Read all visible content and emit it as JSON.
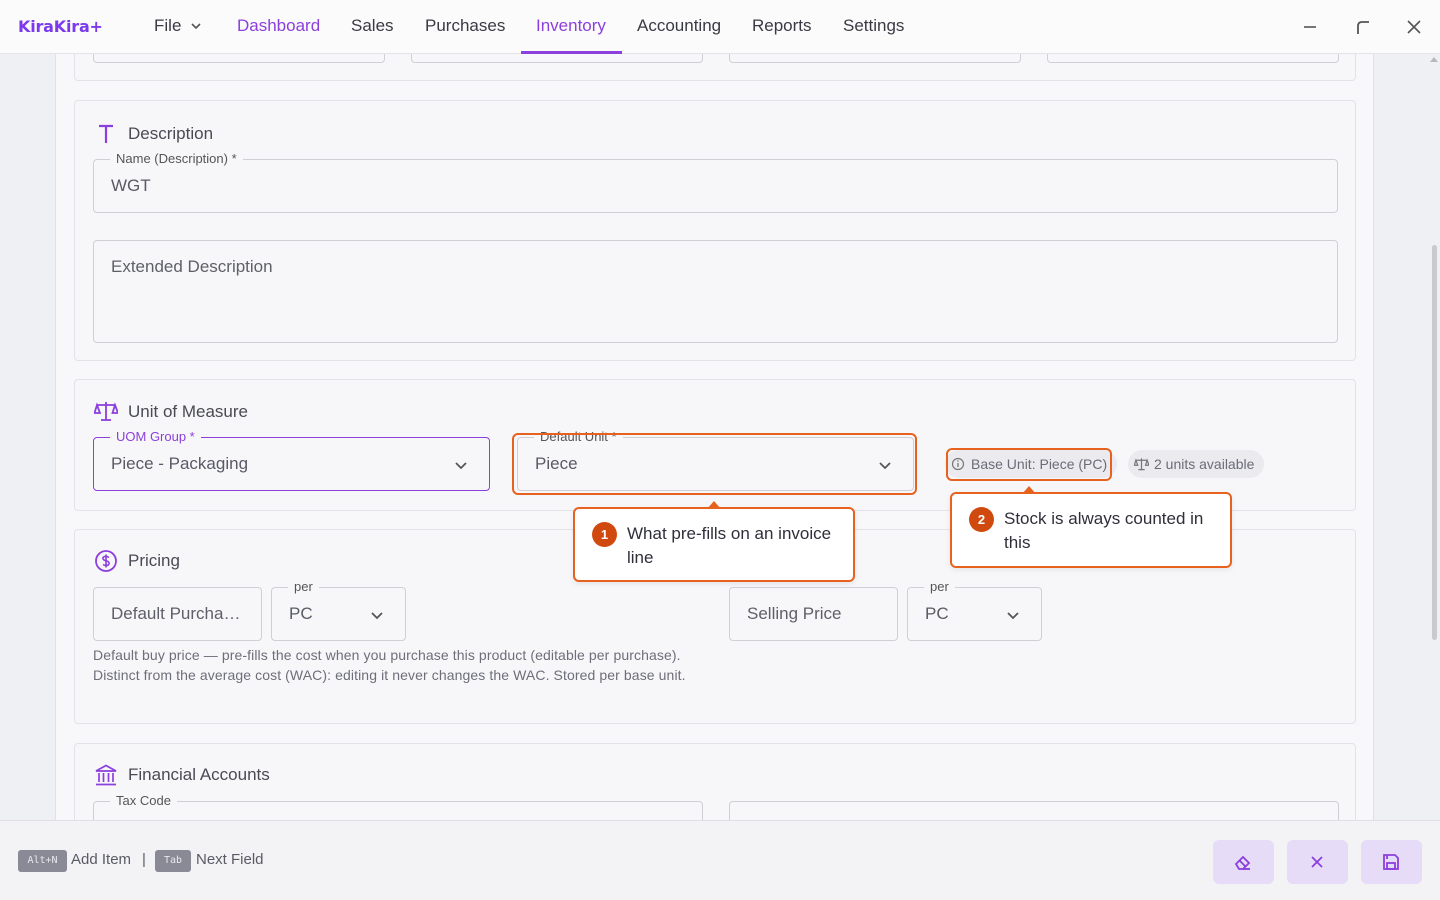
{
  "app": {
    "logo": "KiraKira+"
  },
  "nav": {
    "file": "File",
    "items": [
      "Dashboard",
      "Sales",
      "Purchases",
      "Inventory",
      "Accounting",
      "Reports",
      "Settings"
    ]
  },
  "description": {
    "title": "Description",
    "name_label": "Name (Description) *",
    "name_value": "WGT",
    "extended_placeholder": "Extended Description"
  },
  "uom": {
    "title": "Unit of Measure",
    "group_label": "UOM Group *",
    "group_value": "Piece - Packaging",
    "default_unit_label": "Default Unit *",
    "default_unit_value": "Piece",
    "base_unit_chip": "Base Unit: Piece (PC)",
    "available_chip": "2 units available"
  },
  "callouts": [
    {
      "num": "1",
      "text": "What pre-fills on an invoice line"
    },
    {
      "num": "2",
      "text": "Stock is always counted in this"
    }
  ],
  "pricing": {
    "title": "Pricing",
    "purchase_placeholder": "Default Purcha…",
    "per_label": "per",
    "purchase_unit": "PC",
    "selling_placeholder": "Selling Price",
    "selling_per_label": "per",
    "selling_unit": "PC",
    "helper": "Default buy price — pre-fills the cost when you purchase this product (editable per purchase). Distinct from the average cost (WAC): editing it never changes the WAC. Stored per base unit."
  },
  "financial": {
    "title": "Financial Accounts",
    "tax_code_label": "Tax Code"
  },
  "footer": {
    "shortcut1_key": "Alt+N",
    "shortcut1_label": "Add Item",
    "separator": "|",
    "shortcut2_key": "Tab",
    "shortcut2_label": "Next Field"
  },
  "colors": {
    "accent": "#8b3fdc",
    "annotation": "#e8621f",
    "annotation_badge": "#d04a0f"
  }
}
